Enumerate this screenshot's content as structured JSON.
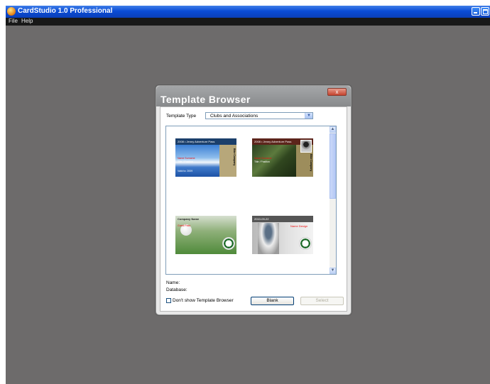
{
  "window": {
    "title": "CardStudio 1.0 Professional"
  },
  "menubar": {
    "items": [
      "File",
      "Help"
    ]
  },
  "dialog": {
    "title": "Template Browser",
    "close_label": "x",
    "template_type_label": "Template Type",
    "template_type_value": "Clubs and Associations",
    "name_label": "Name:",
    "database_label": "Database:",
    "dont_show_label": "Don't show Template Browser",
    "blank_button": "Blank",
    "select_button": "Select",
    "templates": [
      {
        "header": "2008 • Jenny Adventure Pass",
        "line1": "Name Surname",
        "line2": "Title / Position",
        "line3": "Valid to: 2009",
        "side": "Bike Company"
      },
      {
        "header": "2008 • Jenny Adventure Pass",
        "line1": "Name Surname",
        "line2": "Title / Position",
        "line3": "",
        "side": "Bike Company"
      },
      {
        "header": "Company Name",
        "line1": "Guest Pass",
        "line2": "",
        "line3": "",
        "side": ""
      },
      {
        "header": "2010-09-22",
        "line1": "Name Design",
        "line2": "",
        "line3": "",
        "side": ""
      }
    ]
  }
}
